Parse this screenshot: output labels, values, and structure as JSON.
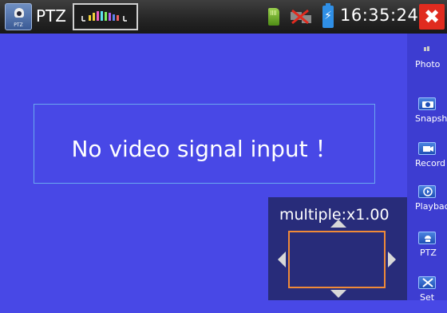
{
  "topbar": {
    "app_icon": "ptz-camera-icon",
    "app_icon_label": "PTZ",
    "title": "PTZ",
    "signal_icon": "signal-strength-icon",
    "sd_icon": "sd-card-icon",
    "network_icon": "network-disconnected-icon",
    "battery_icon": "battery-charging-icon",
    "battery_symbol": "⚡",
    "clock": "16:35:24",
    "close_icon": "close-icon",
    "close_symbol": "✖",
    "close_color": "#e02b1f"
  },
  "video": {
    "message": "No video signal input ！"
  },
  "zoom": {
    "label": "multiple:x1.00",
    "frame_color": "#f08a38"
  },
  "sidebar": {
    "items": [
      {
        "label": "Photo",
        "icon": "photo-icon"
      },
      {
        "label": "Snapshot",
        "icon": "camera-icon"
      },
      {
        "label": "Record",
        "icon": "video-camera-icon"
      },
      {
        "label": "Playback",
        "icon": "playback-icon"
      },
      {
        "label": "PTZ",
        "icon": "ptz-camera-icon"
      },
      {
        "label": "Set",
        "icon": "tools-icon"
      }
    ]
  },
  "colors": {
    "background": "#4848e6",
    "sidebar": "#3d3dd1",
    "panel": "#282c7a"
  }
}
